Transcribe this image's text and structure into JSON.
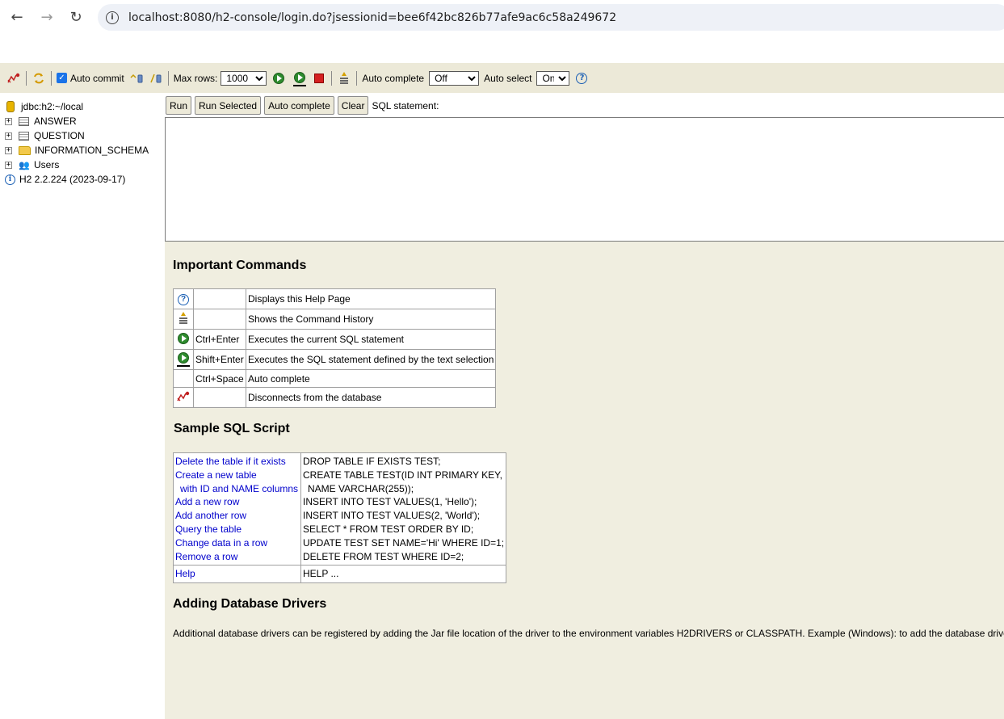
{
  "browser": {
    "back_glyph": "←",
    "forward_glyph": "→",
    "reload_glyph": "↻",
    "info_glyph": "i",
    "url": "localhost:8080/h2-console/login.do?jsessionid=bee6f42bc826b77afe9ac6c58a249672"
  },
  "toolbar": {
    "auto_commit_label": "Auto commit",
    "auto_commit_checked": true,
    "max_rows_label": "Max rows:",
    "max_rows_value": "1000",
    "auto_complete_label": "Auto complete",
    "auto_complete_value": "Off",
    "auto_select_label": "Auto select",
    "auto_select_value": "On",
    "help_glyph": "?"
  },
  "tree": {
    "connection": "jdbc:h2:~/local",
    "items": [
      {
        "label": "ANSWER",
        "icon": "table-icon"
      },
      {
        "label": "QUESTION",
        "icon": "table-icon"
      },
      {
        "label": "INFORMATION_SCHEMA",
        "icon": "folder-icon"
      },
      {
        "label": "Users",
        "icon": "users-icon"
      }
    ],
    "version": "H2 2.2.224 (2023-09-17)"
  },
  "query": {
    "run_label": "Run",
    "run_selected_label": "Run Selected",
    "auto_complete_label": "Auto complete",
    "clear_label": "Clear",
    "sql_label": "SQL statement:",
    "sql_value": ""
  },
  "help": {
    "important_title": "Important Commands",
    "commands": [
      {
        "icon": "help-icon",
        "key": "",
        "desc": "Displays this Help Page"
      },
      {
        "icon": "history-icon",
        "key": "",
        "desc": "Shows the Command History"
      },
      {
        "icon": "run-icon",
        "key": "Ctrl+Enter",
        "desc": "Executes the current SQL statement"
      },
      {
        "icon": "run-selected-icon",
        "key": "Shift+Enter",
        "desc": "Executes the SQL statement defined by the text selection"
      },
      {
        "icon": "",
        "key": "Ctrl+Space",
        "desc": "Auto complete"
      },
      {
        "icon": "disconnect-icon",
        "key": "",
        "desc": "Disconnects from the database"
      }
    ],
    "sample_title": "Sample SQL Script",
    "sample_links": [
      "Delete the table if it exists",
      "Create a new table",
      "with ID and NAME columns",
      "Add a new row",
      "Add another row",
      "Query the table",
      "Change data in a row",
      "Remove a row"
    ],
    "sample_sql": [
      "DROP TABLE IF EXISTS TEST;",
      "CREATE TABLE TEST(ID INT PRIMARY KEY,",
      "NAME VARCHAR(255));",
      "INSERT INTO TEST VALUES(1, 'Hello');",
      "INSERT INTO TEST VALUES(2, 'World');",
      "SELECT * FROM TEST ORDER BY ID;",
      "UPDATE TEST SET NAME='Hi' WHERE ID=1;",
      "DELETE FROM TEST WHERE ID=2;"
    ],
    "help_link": "Help",
    "help_sql": "HELP ...",
    "drivers_title": "Adding Database Drivers",
    "drivers_text": "Additional database drivers can be registered by adding the Jar file location of the driver to the environment variables H2DRIVERS or CLASSPATH. Example (Windows): to add the database driver"
  }
}
